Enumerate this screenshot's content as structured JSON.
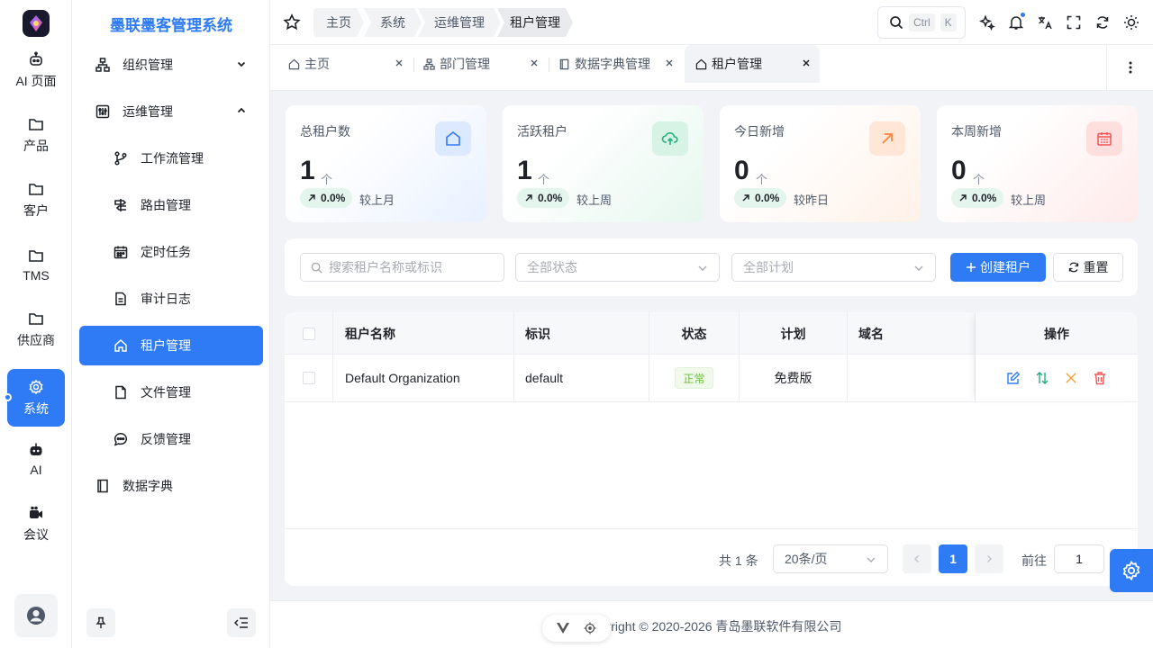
{
  "rail": {
    "items": [
      {
        "label": "AI 页面",
        "icon": "robot-icon"
      },
      {
        "label": "产品",
        "icon": "folder-icon"
      },
      {
        "label": "客户",
        "icon": "folder-icon"
      },
      {
        "label": "TMS",
        "icon": "folder-icon"
      },
      {
        "label": "供应商",
        "icon": "folder-icon"
      },
      {
        "label": "系统",
        "icon": "gear-icon"
      },
      {
        "label": "AI",
        "icon": "robot-icon"
      },
      {
        "label": "会议",
        "icon": "video-icon"
      }
    ]
  },
  "sidebar": {
    "title": "墨联墨客管理系统",
    "items": [
      {
        "label": "组织管理"
      },
      {
        "label": "运维管理"
      },
      {
        "label": "工作流管理"
      },
      {
        "label": "路由管理"
      },
      {
        "label": "定时任务"
      },
      {
        "label": "审计日志"
      },
      {
        "label": "租户管理"
      },
      {
        "label": "文件管理"
      },
      {
        "label": "反馈管理"
      },
      {
        "label": "数据字典"
      }
    ]
  },
  "header": {
    "breadcrumb": [
      "主页",
      "系统",
      "运维管理",
      "租户管理"
    ],
    "search_kbd": [
      "Ctrl",
      "K"
    ]
  },
  "tabs": [
    {
      "label": "主页"
    },
    {
      "label": "部门管理"
    },
    {
      "label": "数据字典管理"
    },
    {
      "label": "租户管理"
    }
  ],
  "stats": [
    {
      "title": "总租户数",
      "value": "1",
      "unit": "个",
      "pct": "0.0%",
      "compare": "较上月",
      "accent": "#2f7bf5"
    },
    {
      "title": "活跃租户",
      "value": "1",
      "unit": "个",
      "pct": "0.0%",
      "compare": "较上周",
      "accent": "#22b07d"
    },
    {
      "title": "今日新增",
      "value": "0",
      "unit": "个",
      "pct": "0.0%",
      "compare": "较昨日",
      "accent": "#f7833c"
    },
    {
      "title": "本周新增",
      "value": "0",
      "unit": "个",
      "pct": "0.0%",
      "compare": "较上周",
      "accent": "#f25757"
    }
  ],
  "filter": {
    "search_placeholder": "搜索租户名称或标识",
    "status_placeholder": "全部状态",
    "plan_placeholder": "全部计划",
    "create_label": "创建租户",
    "reset_label": "重置"
  },
  "table": {
    "columns": [
      "租户名称",
      "标识",
      "状态",
      "计划",
      "域名",
      "操作"
    ],
    "rows": [
      {
        "name": "Default Organization",
        "code": "default",
        "status": "正常",
        "plan": "免费版",
        "domain": ""
      }
    ]
  },
  "pager": {
    "total": "共 1 条",
    "page_size": "20条/页",
    "current": "1",
    "goto_label": "前往",
    "goto_value": "1"
  },
  "footer": {
    "copyright": "Copyright © 2020-2026  青岛墨联软件有限公司"
  }
}
